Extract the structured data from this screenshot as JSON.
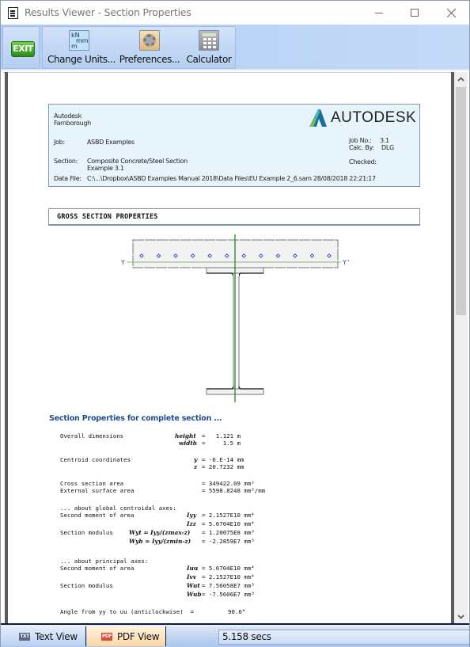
{
  "window": {
    "title": "Results Viewer - Section Properties"
  },
  "toolbar": {
    "exit_label": "EXIT",
    "change_units_label": "Change Units...",
    "change_units_icon_text": [
      "kN",
      "mm",
      "m"
    ],
    "preferences_label": "Preferences...",
    "calculator_label": "Calculator"
  },
  "header": {
    "company_line1": "Autodesk",
    "company_line2": "Farnborough",
    "job_label": "Job:",
    "job_value": "ASBD Examples",
    "section_label": "Section:",
    "section_value_line1": "Composite Concrete/Steel Section",
    "section_value_line2": "Example 3.1",
    "datafile_label": "Data File:",
    "datafile_value": "C:\\...\\Dropbox\\ASBD Examples Manual 2018\\Data Files\\EU Example 2_6.sam 28/08/2018 22:21:17",
    "logo_text": "AUTODESK",
    "jobno_label": "Job No.:",
    "jobno_value": "3.1",
    "calcby_label": "Calc. By:",
    "calcby_value": "DLG",
    "checked_label": "Checked:"
  },
  "gross": {
    "title": "GROSS SECTION PROPERTIES"
  },
  "diagram": {
    "axis_left_label": "Y",
    "axis_right_label": "Y'",
    "rebar_count": 12
  },
  "props": {
    "title": "Section Properties for complete section ...",
    "overall_label": "Overall dimensions",
    "height_sym": "height",
    "height_val": "=   1.121 m",
    "width_sym": "width",
    "width_val": "=     1.5 m",
    "centroid_label": "Centroid coordinates",
    "cy_sym": "y",
    "cy_val": "= -6.E-14 mm",
    "cz_sym": "z",
    "cz_val": "= 20.7232 mm",
    "area_label": "Cross section area",
    "area_val": "= 349422.09 mm²",
    "surface_label": "External surface area",
    "surface_val": "= 5598.8248 mm²/mm",
    "global_heading": "... about global centroidal axes:",
    "second_moment_label": "Second moment of area",
    "iyy_sym": "Iyy",
    "iyy_val": "= 2.1527E10 mm⁴",
    "izz_sym": "Izz",
    "izz_val": "= 5.6704E10 mm⁴",
    "section_modulus_label": "Section modulus",
    "wyt_expr": "Wyt = Iyy/(zmax-z)",
    "wyt_val": "= 1.20075E8 mm³",
    "wyb_expr": "Wyb = Iyy/(zmin-z)",
    "wyb_val": "= -2.2859E7 mm³",
    "principal_heading": "... about principal axes:",
    "iuu_sym": "Iuu",
    "iuu_val": "= 5.6704E10 mm⁴",
    "ivv_sym": "Ivv",
    "ivv_val": "= 2.1527E10 mm⁴",
    "wut_sym": "Wut",
    "wut_val": "= 7.56058E7 mm³",
    "wub_sym": "Wub",
    "wub_val": "= -7.5606E7 mm³",
    "angle_label": "Angle from yy to uu (anticlockwise)  =",
    "angle_val": "90.0°"
  },
  "statusbar": {
    "text_view_label": "Text View",
    "text_view_icon": "TXT",
    "pdf_view_label": "PDF View",
    "pdf_view_icon": "PDF",
    "timing": "5.158 secs"
  }
}
